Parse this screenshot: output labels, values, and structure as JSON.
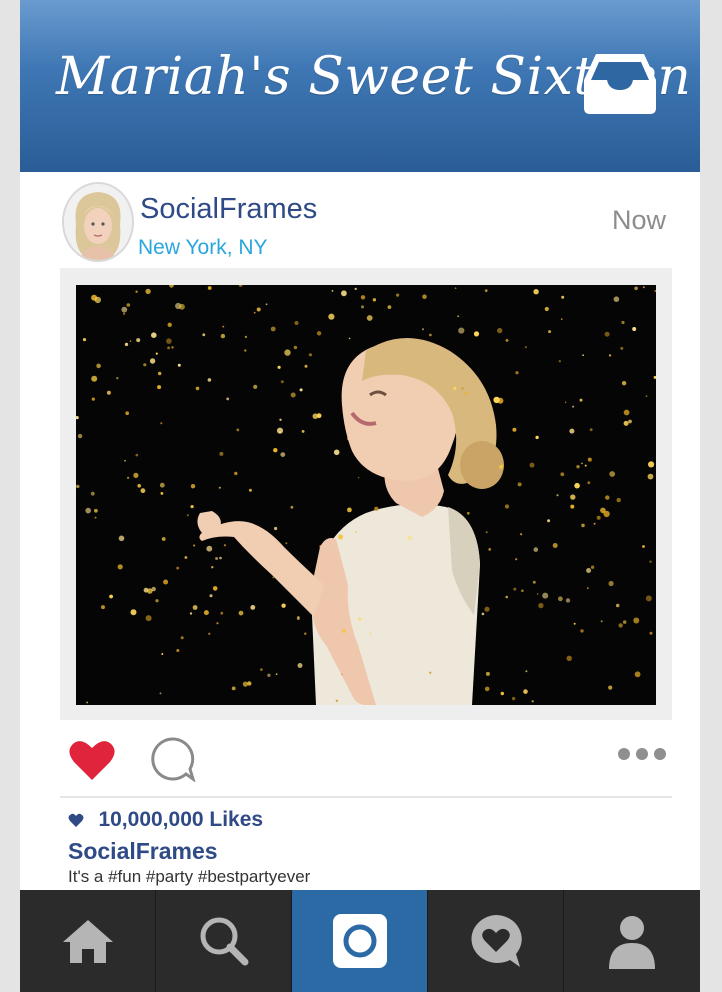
{
  "header": {
    "title": "Mariah's Sweet Sixteen",
    "icon": "inbox-icon",
    "bar_color": "#2f67a3"
  },
  "post": {
    "username": "SocialFrames",
    "location": "New York, NY",
    "time": "Now",
    "avatar": "profile-avatar",
    "photo": "woman-in-gold-confetti"
  },
  "actions": {
    "like_icon": "heart-icon",
    "comment_icon": "comment-icon",
    "more_icon": "more-options-icon",
    "like_color": "#e0243c"
  },
  "likes": {
    "count": "10,000,000 Likes"
  },
  "caption": {
    "username": "SocialFrames",
    "text": "It's a #fun #party #bestpartyever"
  },
  "tabbar": {
    "active_index": 2,
    "active_color": "#2c6aa6",
    "items": [
      {
        "name": "home",
        "icon": "home-icon"
      },
      {
        "name": "search",
        "icon": "search-icon"
      },
      {
        "name": "camera",
        "icon": "camera-icon"
      },
      {
        "name": "activity",
        "icon": "heart-bubble-icon"
      },
      {
        "name": "profile",
        "icon": "profile-icon"
      }
    ]
  }
}
